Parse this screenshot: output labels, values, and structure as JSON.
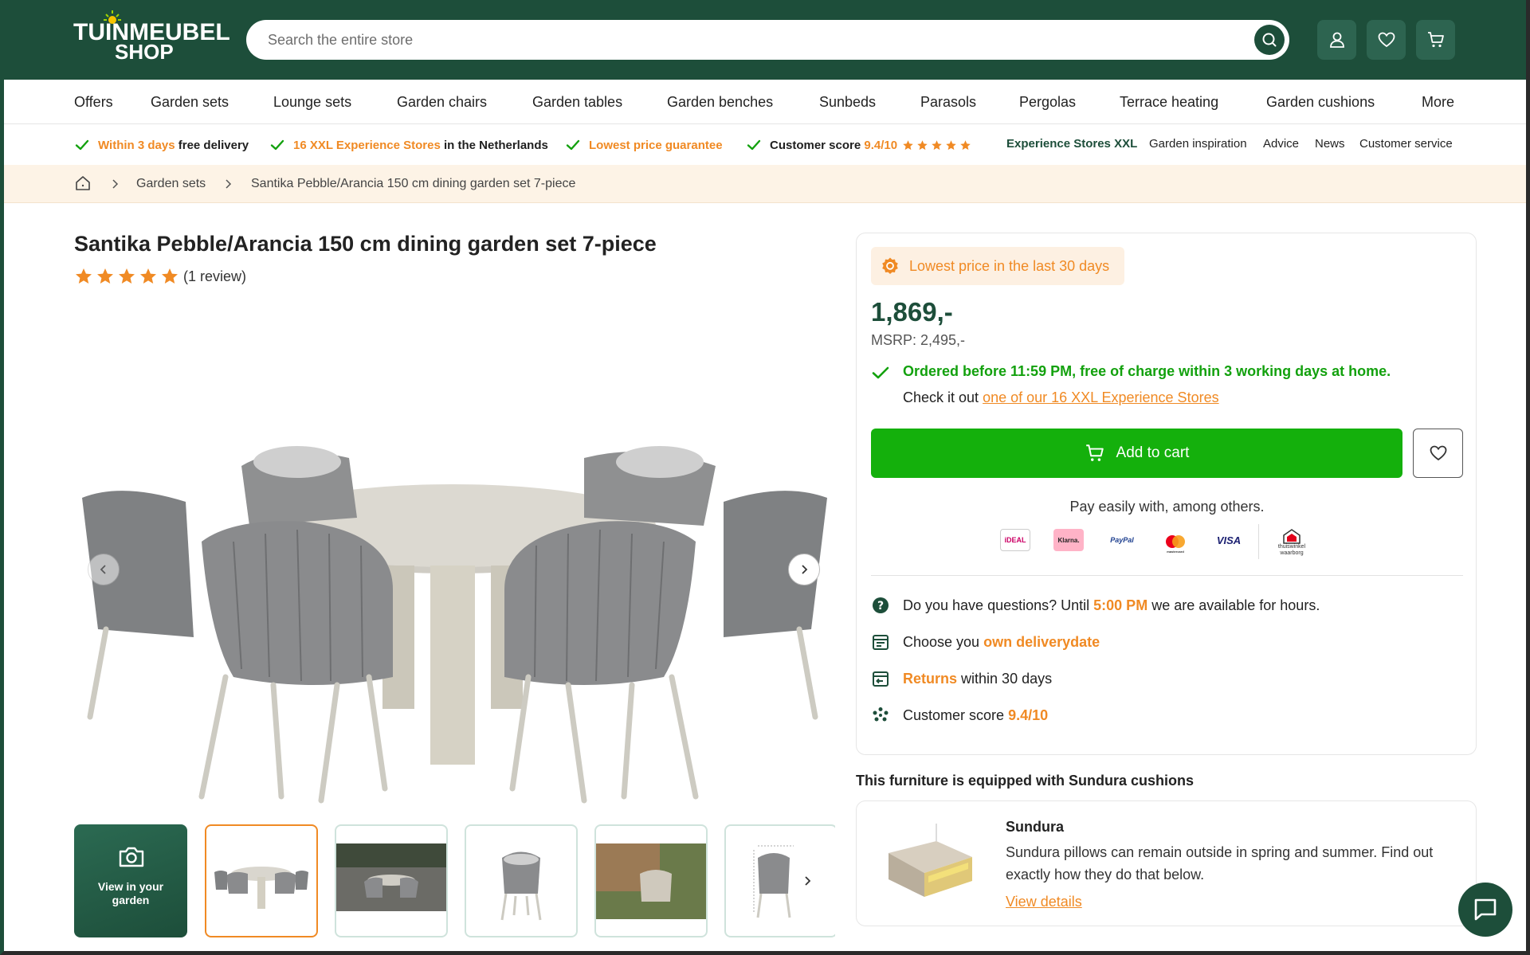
{
  "header": {
    "logo_line1": "TUINMEUBEL",
    "logo_line2": "SHOP",
    "search_placeholder": "Search the entire store",
    "colors": {
      "primary": "#1d4e3a",
      "accent": "#f08a24",
      "cta": "#14b00c"
    }
  },
  "nav": {
    "items": [
      "Offers",
      "Garden sets",
      "Lounge sets",
      "Garden chairs",
      "Garden tables",
      "Garden benches",
      "Sunbeds",
      "Parasols",
      "Pergolas",
      "Terrace heating",
      "Garden cushions",
      "More"
    ]
  },
  "usp": {
    "delivery_highlight": "Within 3 days",
    "delivery_rest": "free delivery",
    "stores_highlight": "16 XXL Experience Stores",
    "stores_rest": "in the Netherlands",
    "price_guarantee": "Lowest price guarantee",
    "score_label": "Customer score",
    "score_value": "9.4/10",
    "links": [
      "Experience Stores XXL",
      "Garden inspiration",
      "Advice",
      "News",
      "Customer service"
    ]
  },
  "breadcrumb": {
    "items": [
      "Garden sets",
      "Santika Pebble/Arancia 150 cm dining garden set 7-piece"
    ]
  },
  "product": {
    "title": "Santika Pebble/Arancia 150 cm dining garden set 7-piece",
    "rating": 5,
    "review_count": "(1 review)",
    "view_in_garden": "View in your garden"
  },
  "purchase": {
    "lowest_price_label": "Lowest price in the last 30 days",
    "price": "1,869,-",
    "msrp": "MSRP: 2,495,-",
    "delivery_text": "Ordered before 11:59 PM, free of charge within 3 working days at home.",
    "check_prefix": "Check it out",
    "check_link": "one of our 16 XXL Experience Stores",
    "add_to_cart": "Add to cart",
    "pay_title": "Pay easily with, among others.",
    "payment_methods": [
      "iDEAL",
      "Klarna.",
      "PayPal",
      "mastercard",
      "VISA",
      "thuiswinkel waarborg"
    ],
    "questions_prefix": "Do you have questions? Until",
    "questions_time": "5:00 PM",
    "questions_suffix": "we are available for hours.",
    "choose_prefix": "Choose you",
    "choose_link": "own deliverydate",
    "returns_link": "Returns",
    "returns_suffix": "within 30 days",
    "score_prefix": "Customer score",
    "score_value": "9.4/10"
  },
  "cushions": {
    "section_title": "This furniture is equipped with Sundura cushions",
    "name": "Sundura",
    "description": "Sundura pillows can remain outside in spring and summer. Find out exactly how they do that below.",
    "link": "View details"
  }
}
